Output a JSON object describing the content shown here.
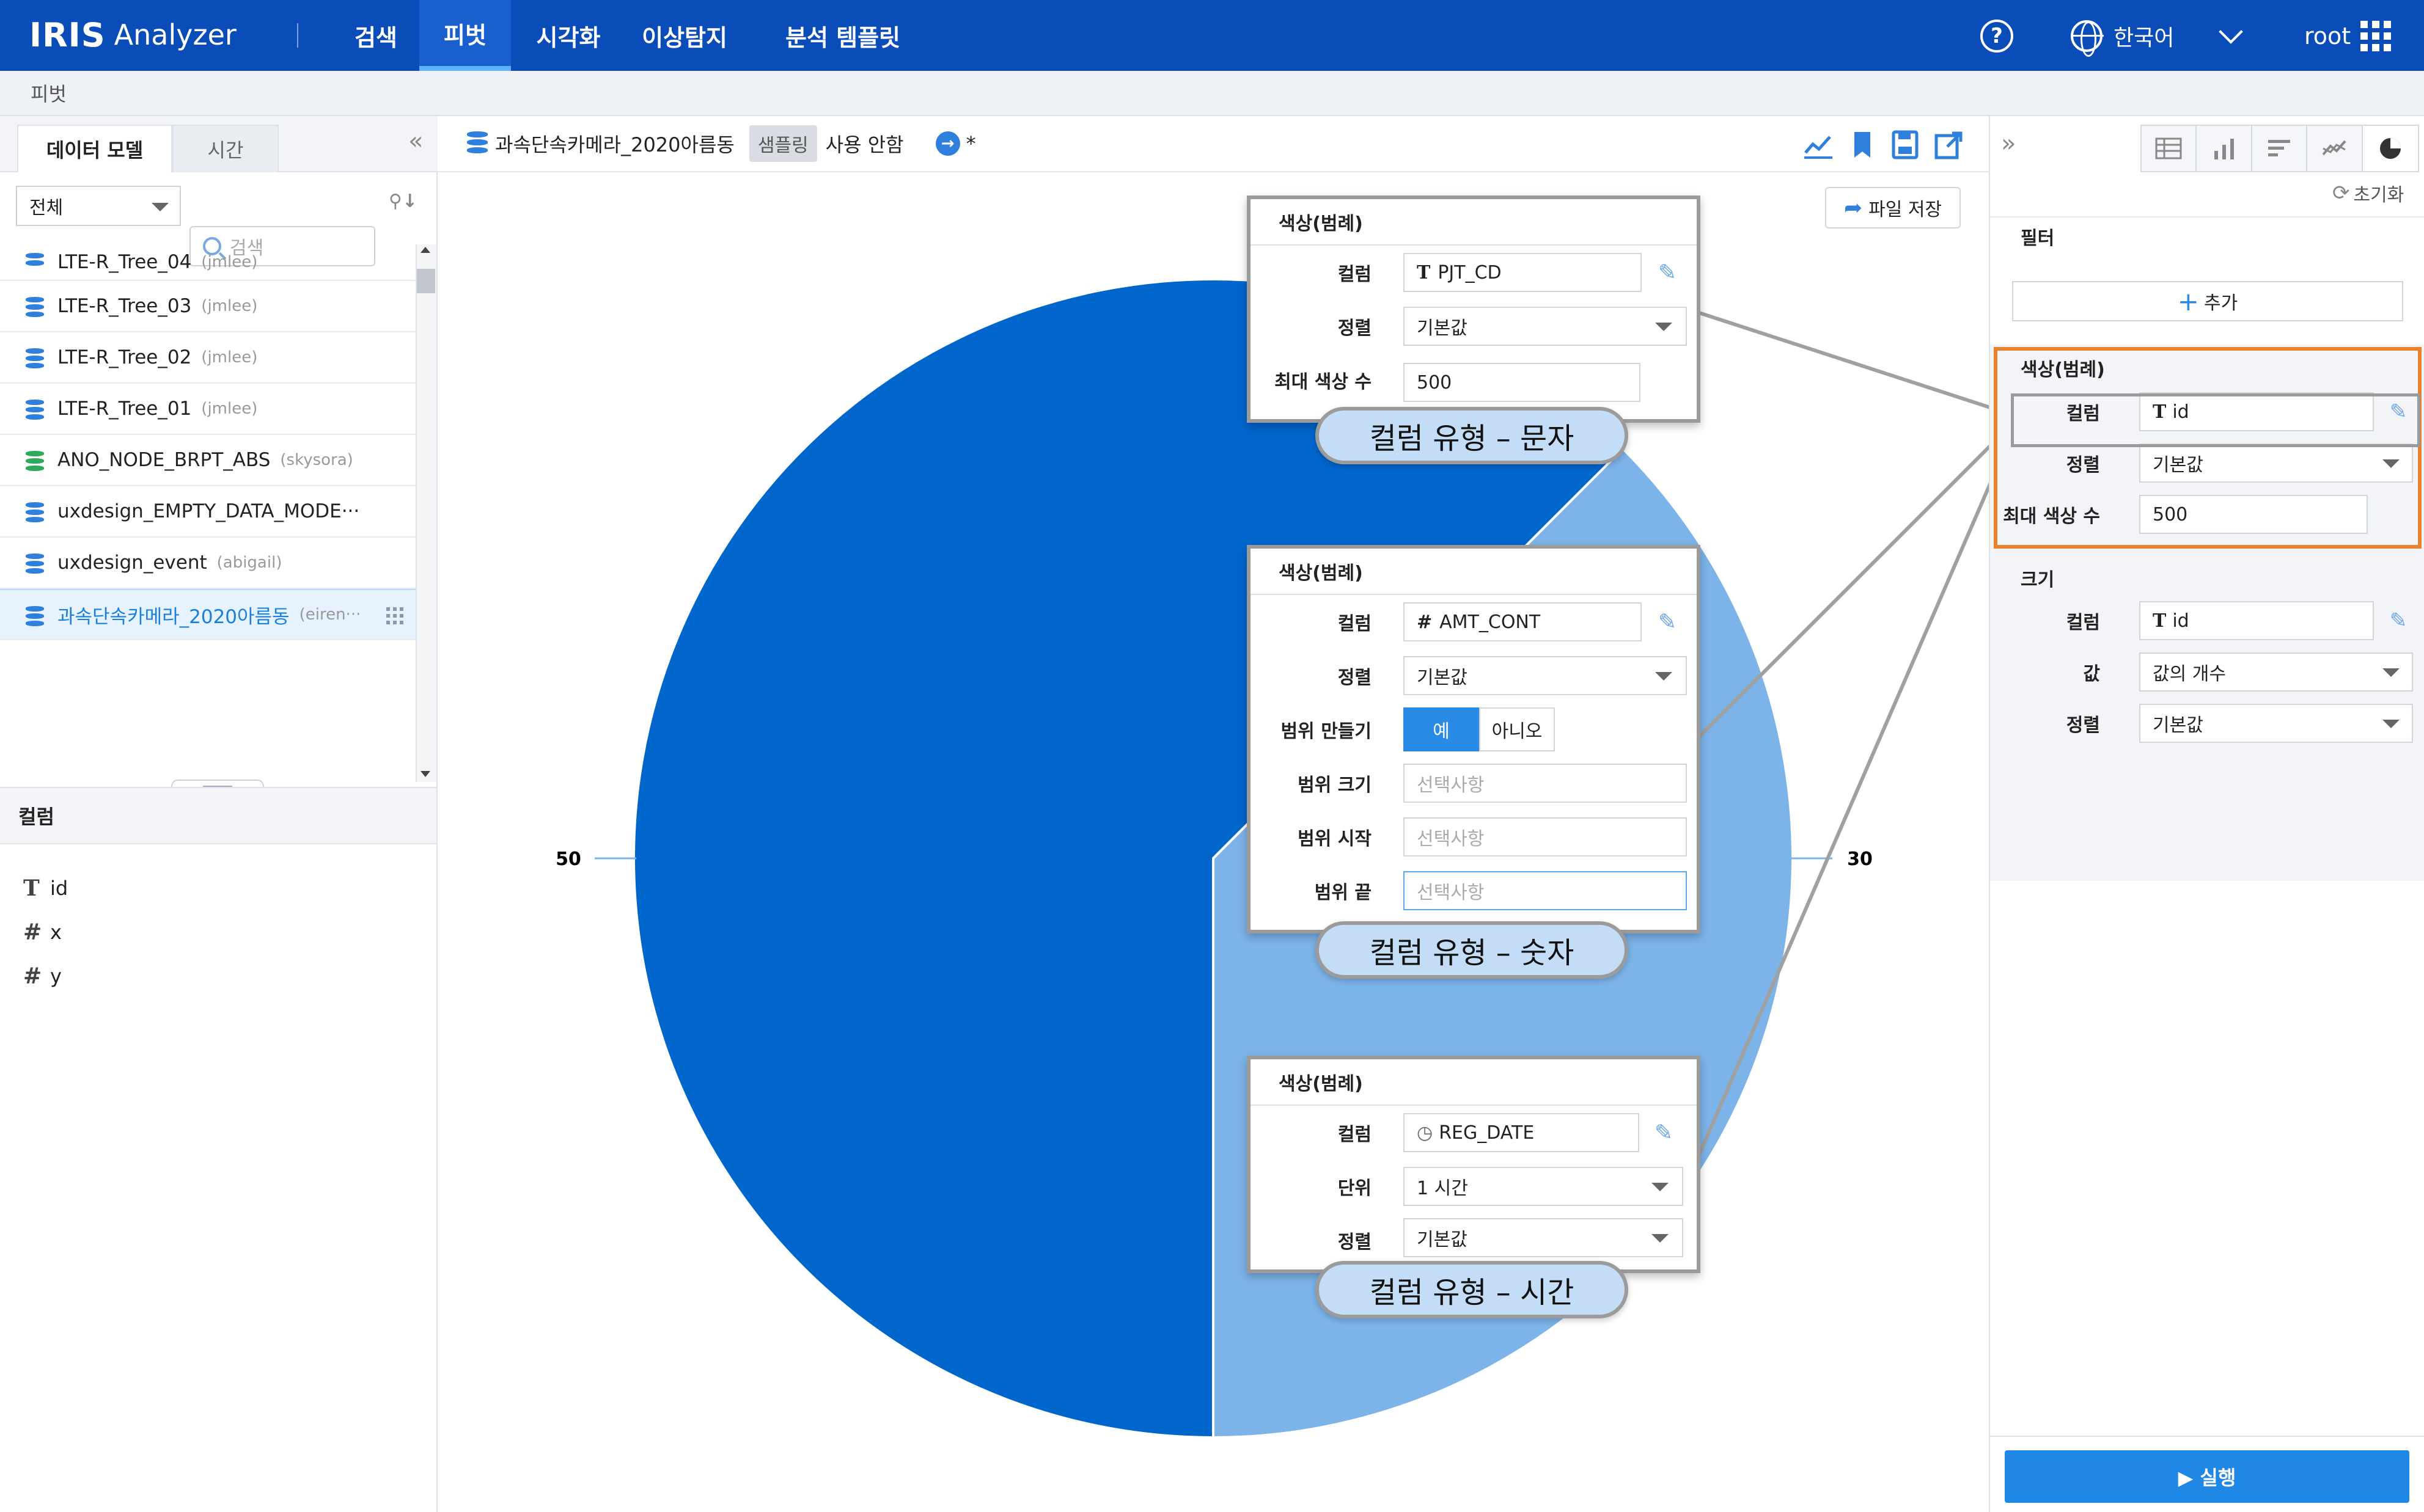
{
  "app": {
    "logo_mark": "IRIS",
    "logo_name": "Analyzer"
  },
  "nav": {
    "items": [
      {
        "label": "검색"
      },
      {
        "label": "피벗"
      },
      {
        "label": "시각화"
      },
      {
        "label": "이상탐지"
      },
      {
        "label": "분석 템플릿"
      }
    ],
    "active": "피벗",
    "language": "한국어",
    "user": "root"
  },
  "breadcrumb": "피벗",
  "left_panel": {
    "tabs": [
      "데이터 모델",
      "시간"
    ],
    "filter_select": "전체",
    "search_placeholder": "검색",
    "models": [
      {
        "name": "LTE-R_Tree_04",
        "owner": "(jmlee)"
      },
      {
        "name": "LTE-R_Tree_03",
        "owner": "(jmlee)"
      },
      {
        "name": "LTE-R_Tree_02",
        "owner": "(jmlee)"
      },
      {
        "name": "LTE-R_Tree_01",
        "owner": "(jmlee)"
      },
      {
        "name": "ANO_NODE_BRPT_ABS",
        "owner": "(skysora)"
      },
      {
        "name": "uxdesign_EMPTY_DATA_MODE···",
        "owner": ""
      },
      {
        "name": "uxdesign_event",
        "owner": "(abigail)"
      },
      {
        "name": "과속단속카메라_2020아름동",
        "owner": "(eiren···"
      }
    ],
    "columns_header": "컬럼",
    "columns": [
      {
        "type": "T",
        "name": "id"
      },
      {
        "type": "#",
        "name": "x"
      },
      {
        "type": "#",
        "name": "y"
      }
    ]
  },
  "toolbar": {
    "model_name": "과속단속카메라_2020아름동",
    "sampling_label": "샘플링",
    "sampling_status": "사용 안함",
    "run_mark": "→",
    "modified_mark": "*",
    "save_file": "파일 저장"
  },
  "chart_data": {
    "type": "pie",
    "categories": [
      "50",
      "30"
    ],
    "values": [
      50,
      30
    ],
    "colors": [
      "#0066cc",
      "#7cb4ea"
    ]
  },
  "callouts": [
    {
      "title": "색상(범례)",
      "rows": [
        {
          "label": "컬럼",
          "value": "PJT_CD",
          "type_icon": "T"
        },
        {
          "label": "정렬",
          "value": "기본값"
        },
        {
          "label": "최대 색상 수",
          "value": "500"
        }
      ],
      "caption": "컬럼 유형 – 문자"
    },
    {
      "title": "색상(범례)",
      "rows": [
        {
          "label": "컬럼",
          "value": "AMT_CONT",
          "type_icon": "#"
        },
        {
          "label": "정렬",
          "value": "기본값"
        },
        {
          "label": "범위 만들기",
          "yes": "예",
          "no": "아니오"
        },
        {
          "label": "범위 크기",
          "placeholder": "선택사항"
        },
        {
          "label": "범위 시작",
          "placeholder": "선택사항"
        },
        {
          "label": "범위 끝",
          "placeholder": "선택사항"
        }
      ],
      "caption": "컬럼 유형 – 숫자"
    },
    {
      "title": "색상(범례)",
      "rows": [
        {
          "label": "컬럼",
          "value": "REG_DATE",
          "type_icon": "clock"
        },
        {
          "label": "단위",
          "value": "1 시간"
        },
        {
          "label": "정렬",
          "value": "기본값"
        }
      ],
      "caption": "컬럼 유형 – 시간"
    }
  ],
  "right_panel": {
    "reset": "초기화",
    "filter_section": "필터",
    "add_button": "추가",
    "color_section": {
      "title": "색상(범례)",
      "column_label": "컬럼",
      "column_value": "id",
      "sort_label": "정렬",
      "sort_value": "기본값",
      "max_label": "최대 색상 수",
      "max_value": "500"
    },
    "size_section": {
      "title": "크기",
      "column_label": "컬럼",
      "column_value": "id",
      "value_label": "값",
      "value_value": "값의 개수",
      "sort_label": "정렬",
      "sort_value": "기본값"
    },
    "run_button": "▶ 실행"
  }
}
